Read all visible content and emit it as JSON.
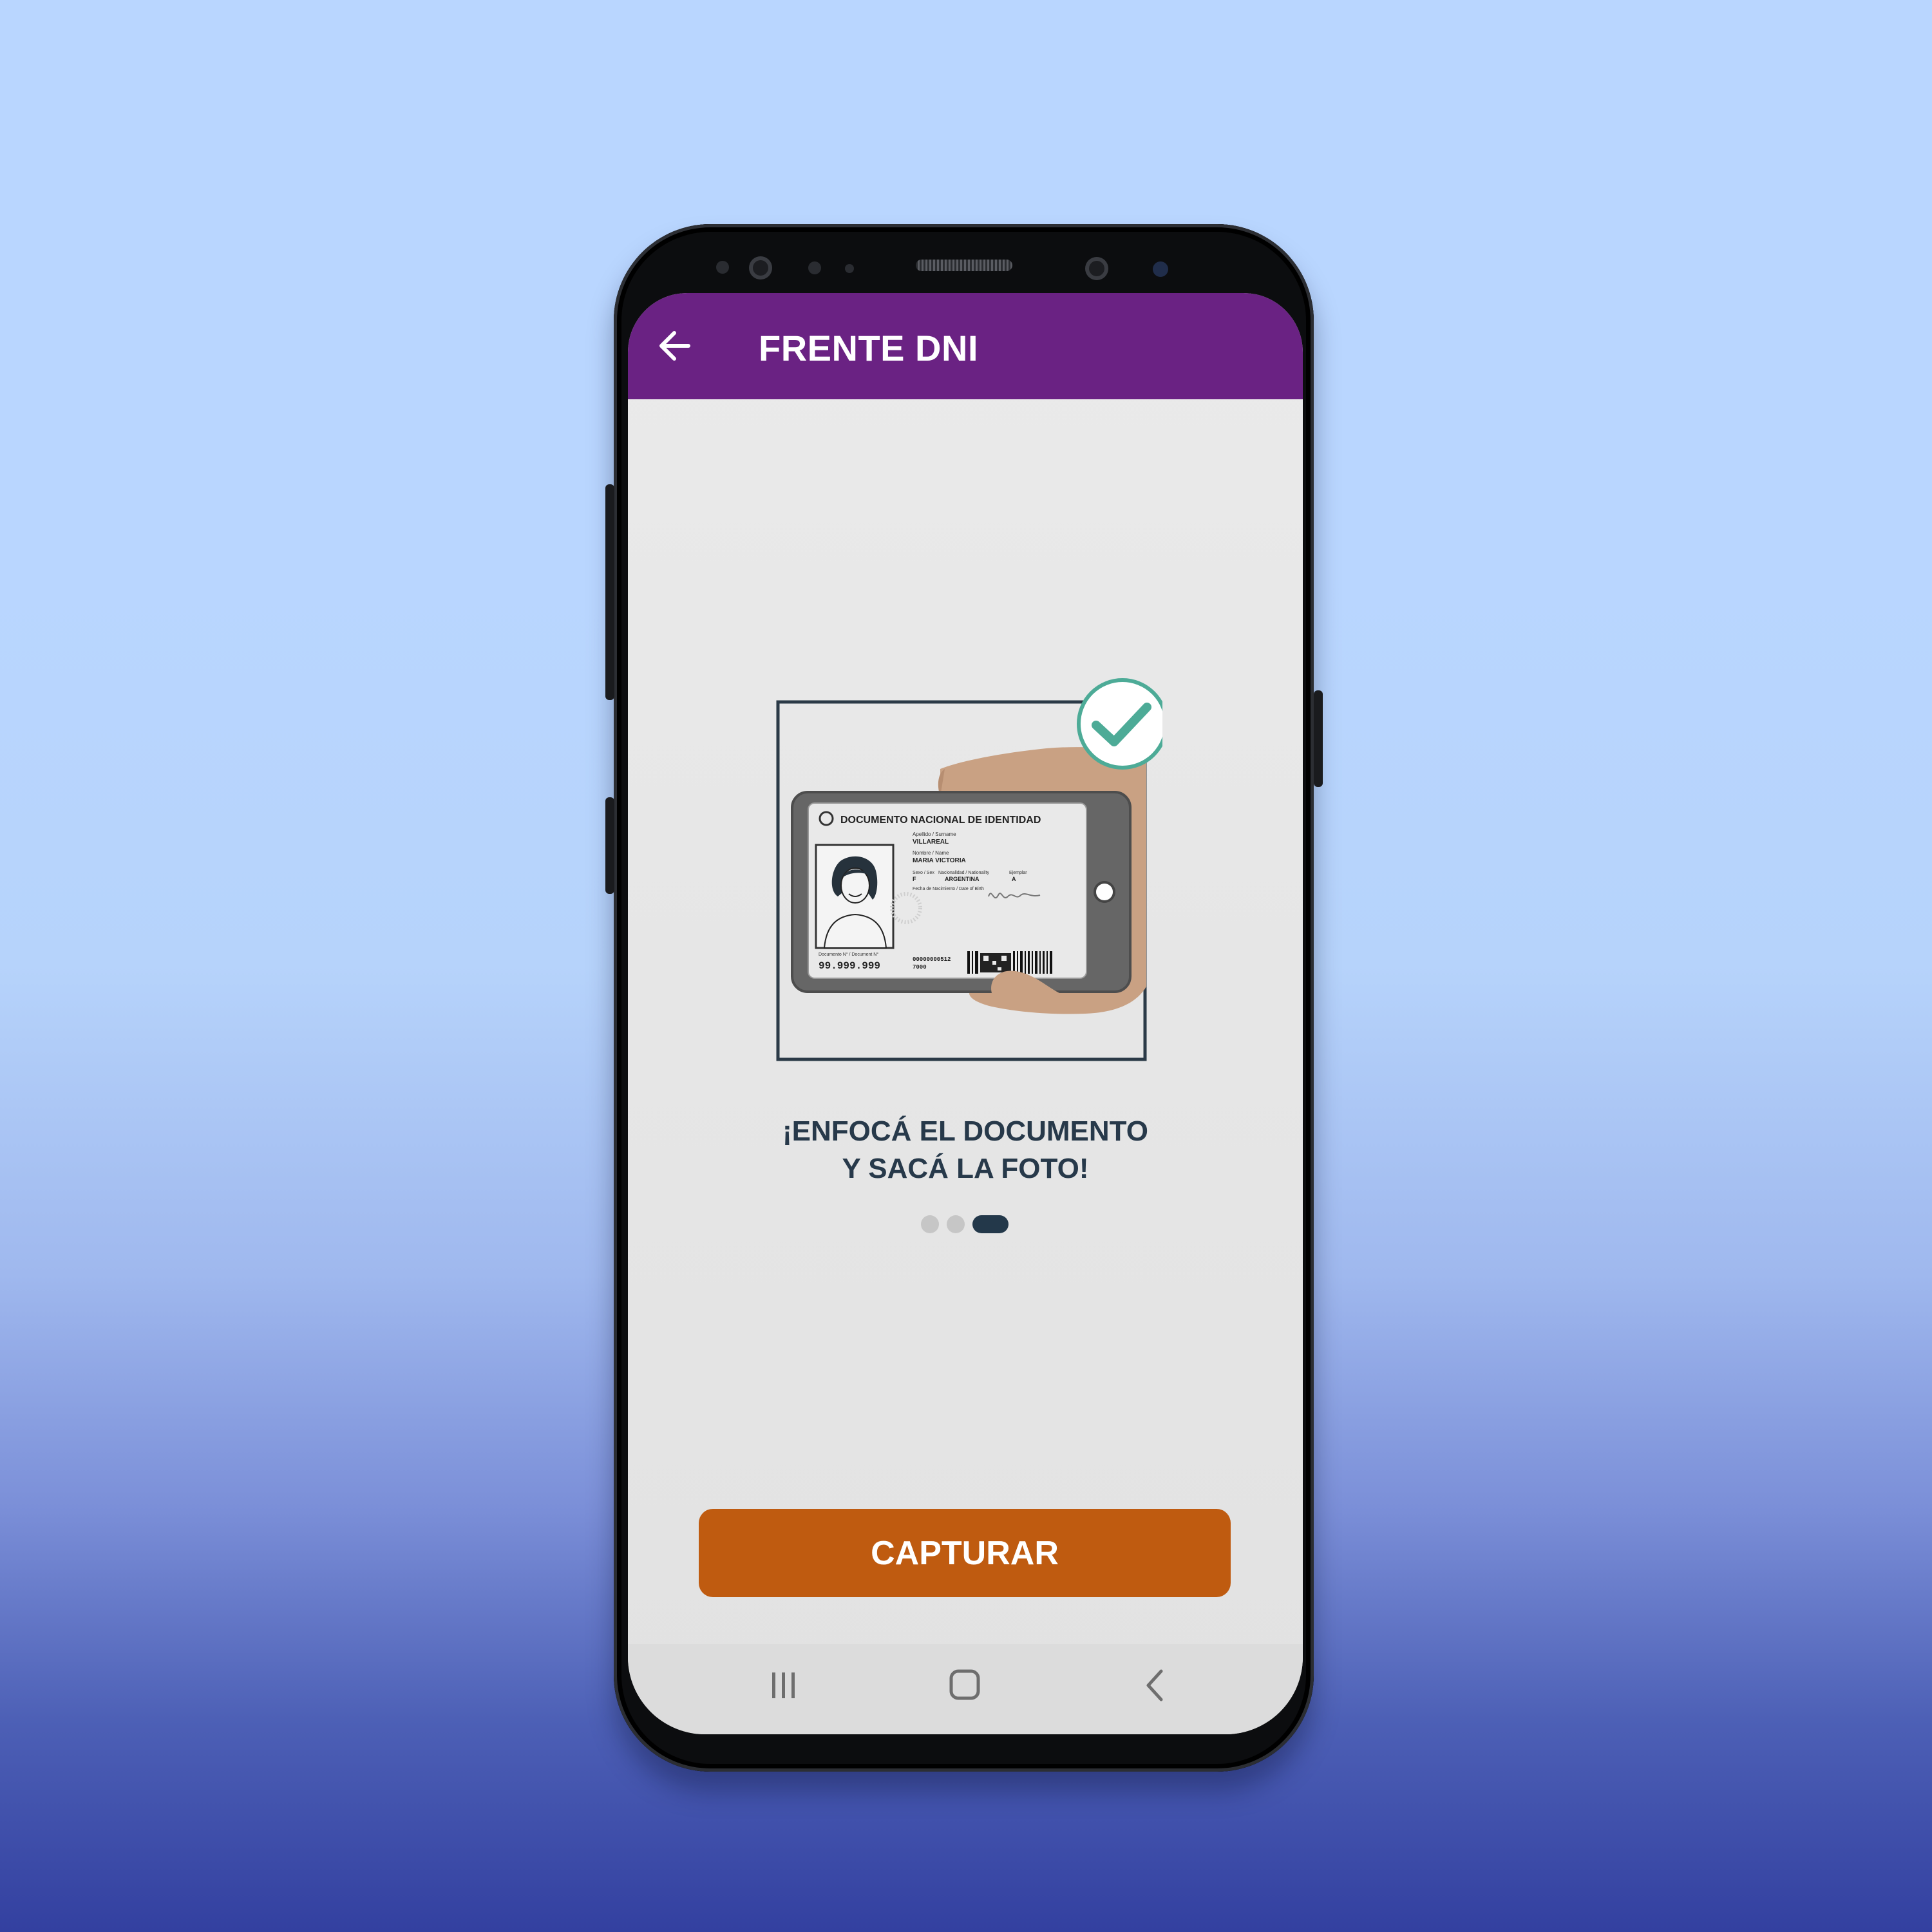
{
  "colors": {
    "app_bar": "#6a2283",
    "primary_button": "#bf5b10",
    "headline_text": "#27394a",
    "check_accent": "#4dab97",
    "dot_active": "#23384a",
    "dot_inactive": "#c6c6c6"
  },
  "app_bar": {
    "back_icon": "arrow-left-icon",
    "title": "FRENTE DNI"
  },
  "illustration": {
    "card_title": "DOCUMENTO NACIONAL DE IDENTIDAD",
    "surname_label": "Apellido / Surname",
    "surname": "VILLAREAL",
    "name_label": "Nombre / Name",
    "name": "MARIA VICTORIA",
    "sex_label": "Sexo / Sex",
    "sex": "F",
    "nationality_label": "Nacionalidad / Nationality",
    "nationality": "ARGENTINA",
    "copy_label": "Ejemplar",
    "copy": "A",
    "birth_label": "Fecha de Nacimiento / Date of Birth",
    "doc_label": "Documento N° / Document N°",
    "doc_number": "99.999.999",
    "tramite": "00000000512",
    "tramite_2": "7000"
  },
  "instruction": {
    "line1": "¡ENFOCÁ EL DOCUMENTO",
    "line2": "Y SACÁ LA FOTO!"
  },
  "pager": {
    "total": 3,
    "active_index": 2
  },
  "capture_button": {
    "label": "CAPTURAR"
  },
  "nav_bar": {
    "recents_icon": "recents-icon",
    "home_icon": "home-icon",
    "back_icon": "chevron-left-icon"
  }
}
